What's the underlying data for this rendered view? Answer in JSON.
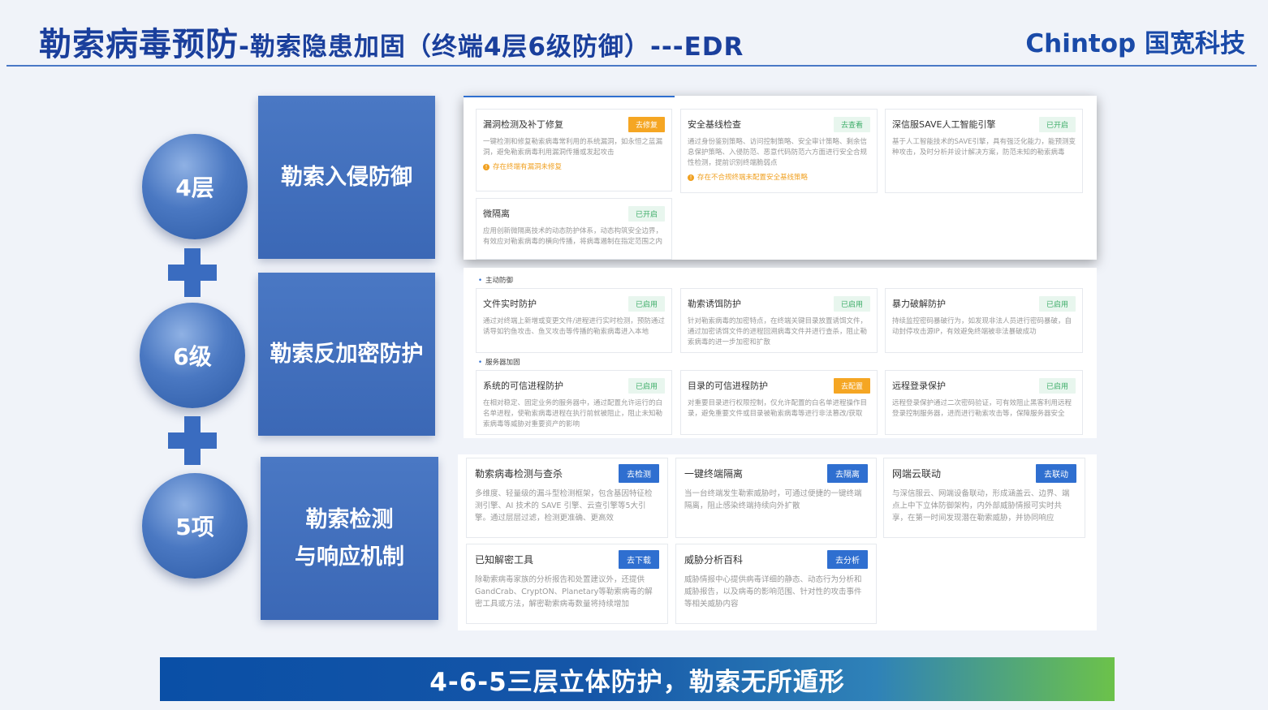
{
  "header": {
    "title_main": "勒索病毒预防",
    "title_sub": "-勒索隐患加固（终端4层6级防御）---EDR",
    "brand": "Chintop  国宽科技"
  },
  "tiers": [
    {
      "circle": "4层",
      "label": "勒索入侵防御"
    },
    {
      "circle": "6级",
      "label": "勒索反加密防护"
    },
    {
      "circle": "5项",
      "label_line1": "勒索检测",
      "label_line2": "与响应机制"
    }
  ],
  "panel1": {
    "cards": [
      {
        "title": "漏洞检测及补丁修复",
        "button": "去修复",
        "desc": "一键检测和修复勒索病毒常利用的系统漏洞，如永恒之蓝漏洞，避免勒索病毒利用漏洞传播或发起攻击",
        "warn": "存在终端有漏洞未修复"
      },
      {
        "title": "安全基线检查",
        "button": "去查看",
        "desc": "通过身份鉴别策略、访问控制策略、安全审计策略、剩余信息保护策略、入侵防范、恶意代码防范六方面进行安全合规性检测，提前识别终端脆弱点",
        "warn": "存在不合规终端未配置安全基线策略"
      },
      {
        "title": "深信服SAVE人工智能引擎",
        "button": "已开启",
        "desc": "基于人工智能技术的SAVE引擎，具有强泛化能力，能预测变种攻击，及时分析并设计解决方案，防范未知的勒索病毒"
      },
      {
        "title": "微隔离",
        "button": "已开启",
        "desc": "应用创新微隔离技术的动态防护体系，动态构筑安全边界，有效应对勒索病毒的横向传播，将病毒遏制在指定范围之内"
      }
    ]
  },
  "panel2": {
    "section1": "主动防御",
    "section2": "服务器加固",
    "cards": [
      {
        "title": "文件实时防护",
        "button": "已启用",
        "desc": "通过对终端上新增或变更文件/进程进行实时检测，预防通过诱导如钓鱼攻击、鱼叉攻击等传播的勒索病毒进入本地"
      },
      {
        "title": "勒索诱饵防护",
        "button": "已启用",
        "desc": "针对勒索病毒的加密特点，在终端关键目录放置诱饵文件，通过加密诱饵文件的进程回溯病毒文件并进行查杀，阻止勒索病毒的进一步加密和扩散"
      },
      {
        "title": "暴力破解防护",
        "button": "已启用",
        "desc": "持续监控密码暴破行为，如发现非法人员进行密码暴破，自动封停攻击源IP，有效避免终端被非法暴破成功"
      },
      {
        "title": "系统的可信进程防护",
        "button": "已启用",
        "desc": "在相对稳定、固定业务的服务器中，通过配置允许运行的白名单进程，使勒索病毒进程在执行前就被阻止，阻止未知勒索病毒等威胁对重要资产的影响"
      },
      {
        "title": "目录的可信进程防护",
        "button": "去配置",
        "desc": "对重要目录进行权限控制，仅允许配置的白名单进程操作目录，避免重要文件或目录被勒索病毒等进行非法篡改/获取"
      },
      {
        "title": "远程登录保护",
        "button": "已启用",
        "desc": "远程登录保护通过二次密码验证，可有效阻止黑客利用远程登录控制服务器，进而进行勒索攻击等，保障服务器安全"
      }
    ]
  },
  "panel3": {
    "cards": [
      {
        "title": "勒索病毒检测与查杀",
        "button": "去检测",
        "desc": "多维度、轻量级的漏斗型检测框架，包含基因特征检测引擎、AI 技术的 SAVE 引擎、云查引擎等5大引擎。通过层层过滤，检测更准确、更高效"
      },
      {
        "title": "一键终端隔离",
        "button": "去隔离",
        "desc": "当一台终端发生勒索威胁时，可通过便捷的一键终端隔离，阻止感染终端持续向外扩散"
      },
      {
        "title": "网端云联动",
        "button": "去联动",
        "desc": "与深信服云、网端设备联动，形成涵盖云、边界、端点上中下立体防御架构，内外部威胁情报可实时共享，在第一时间发现潜在勒索威胁，并协同响应"
      },
      {
        "title": "已知解密工具",
        "button": "去下载",
        "desc": "除勒索病毒家族的分析报告和处置建议外，还提供GandCrab、CryptON、Planetary等勒索病毒的解密工具或方法，解密勒索病毒数量将持续增加"
      },
      {
        "title": "威胁分析百科",
        "button": "去分析",
        "desc": "威胁情报中心提供病毒详细的静态、动态行为分析和威胁报告，以及病毒的影响范围、针对性的攻击事件等相关威胁内容"
      }
    ]
  },
  "footer": {
    "text": "4-6-5三层立体防护，勒索无所遁形"
  },
  "colors": {
    "primary": "#1a3f9c",
    "accent_blue": "#2f6fd0",
    "warn_orange": "#f5a623",
    "ok_green": "#3fae6a"
  }
}
